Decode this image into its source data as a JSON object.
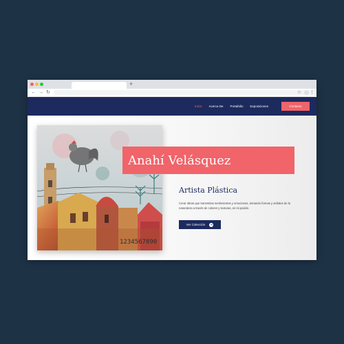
{
  "browser": {
    "new_tab_icon": "+",
    "star_icon": "☆",
    "menu_icon": "⋮"
  },
  "site": {
    "nav": {
      "items": [
        "Inicio",
        "Acerca De",
        "Portafolio",
        "Exposiciones"
      ],
      "active_index": 0,
      "cta": "Contacto"
    },
    "hero": {
      "name": "Anahí Velásquez",
      "subtitle": "Artista Plástica",
      "description": "Crear obras que transmitan sentimientos y emociones, tomando formas y señales de la naturaleza a través de colores y texturas, es mi pasión.",
      "button_label": "Ver Colección",
      "button_icon": "arrow-right-circle-icon",
      "painting_text": "1234567890"
    }
  },
  "colors": {
    "background": "#1e3246",
    "nav": "#1c2a5e",
    "accent": "#f0646a"
  }
}
